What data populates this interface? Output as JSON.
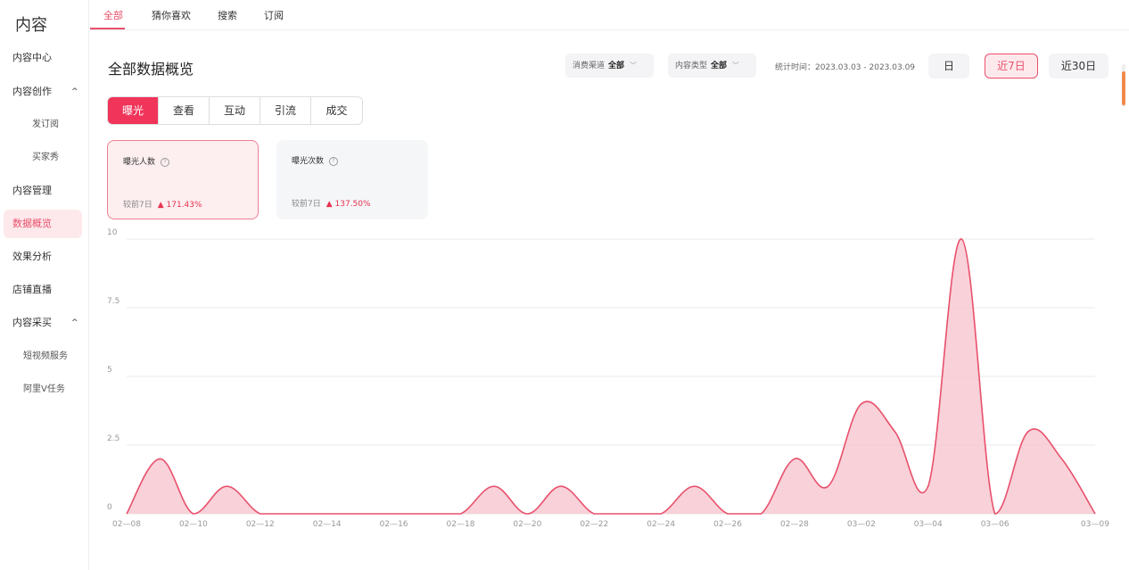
{
  "sidebar": {
    "title": "内容",
    "items": [
      {
        "label": "内容中心"
      },
      {
        "label": "内容创作",
        "caret": "^"
      },
      {
        "label": "发订阅"
      },
      {
        "label": "买家秀"
      },
      {
        "label": "内容管理"
      },
      {
        "label": "数据概览"
      },
      {
        "label": "效果分析"
      },
      {
        "label": "店铺直播"
      },
      {
        "label": "内容采买",
        "caret": "^"
      },
      {
        "label": "短视频服务"
      },
      {
        "label": "阿里V任务"
      }
    ]
  },
  "top_tabs": [
    "全部",
    "猜你喜欢",
    "搜索",
    "订阅"
  ],
  "header": {
    "title": "全部数据概览",
    "filters": [
      {
        "label": "消费渠道",
        "value": "全部"
      },
      {
        "label": "内容类型",
        "value": "全部"
      }
    ],
    "stat_time": "统计时间：2023.03.03 - 2023.03.09",
    "ranges": [
      "日",
      "近7日",
      "近30日"
    ],
    "active_range": "近7日"
  },
  "metric_tabs": [
    "曝光",
    "查看",
    "互动",
    "引流",
    "成交"
  ],
  "cards": [
    {
      "label": "曝光人数",
      "help": "?",
      "compare_label": "较前7日",
      "change": "▲ 171.43%"
    },
    {
      "label": "曝光次数",
      "help": "?",
      "compare_label": "较前7日",
      "change": "▲ 137.50%"
    }
  ],
  "colors": {
    "accent": "#e8506b",
    "area_fill": "#f7c9d2",
    "line": "#e8506b"
  },
  "chart_data": {
    "type": "area",
    "title": "",
    "xlabel": "",
    "ylabel": "",
    "ylim": [
      0,
      10
    ],
    "yticks": [
      "0",
      "2.5",
      "5",
      "7.5",
      "10"
    ],
    "xticks": [
      "02—08",
      "02—10",
      "02—12",
      "02—14",
      "02—16",
      "02—18",
      "02—20",
      "02—22",
      "02—24",
      "02—26",
      "02—28",
      "03—02",
      "03—04",
      "03—06",
      "03—09"
    ],
    "x": [
      "02-08",
      "02-09",
      "02-10",
      "02-11",
      "02-12",
      "02-13",
      "02-14",
      "02-15",
      "02-16",
      "02-17",
      "02-18",
      "02-19",
      "02-20",
      "02-21",
      "02-22",
      "02-23",
      "02-24",
      "02-25",
      "02-26",
      "02-27",
      "02-28",
      "03-01",
      "03-02",
      "03-03",
      "03-04",
      "03-05",
      "03-06",
      "03-07",
      "03-08",
      "03-09"
    ],
    "series": [
      {
        "values": [
          0,
          2,
          0,
          1,
          0,
          0,
          0,
          0,
          0,
          0,
          0,
          1,
          0,
          1,
          0,
          0,
          0,
          1,
          0,
          0,
          2,
          1,
          4,
          3,
          1,
          10,
          0,
          3,
          2,
          0
        ]
      }
    ],
    "grid": true
  }
}
